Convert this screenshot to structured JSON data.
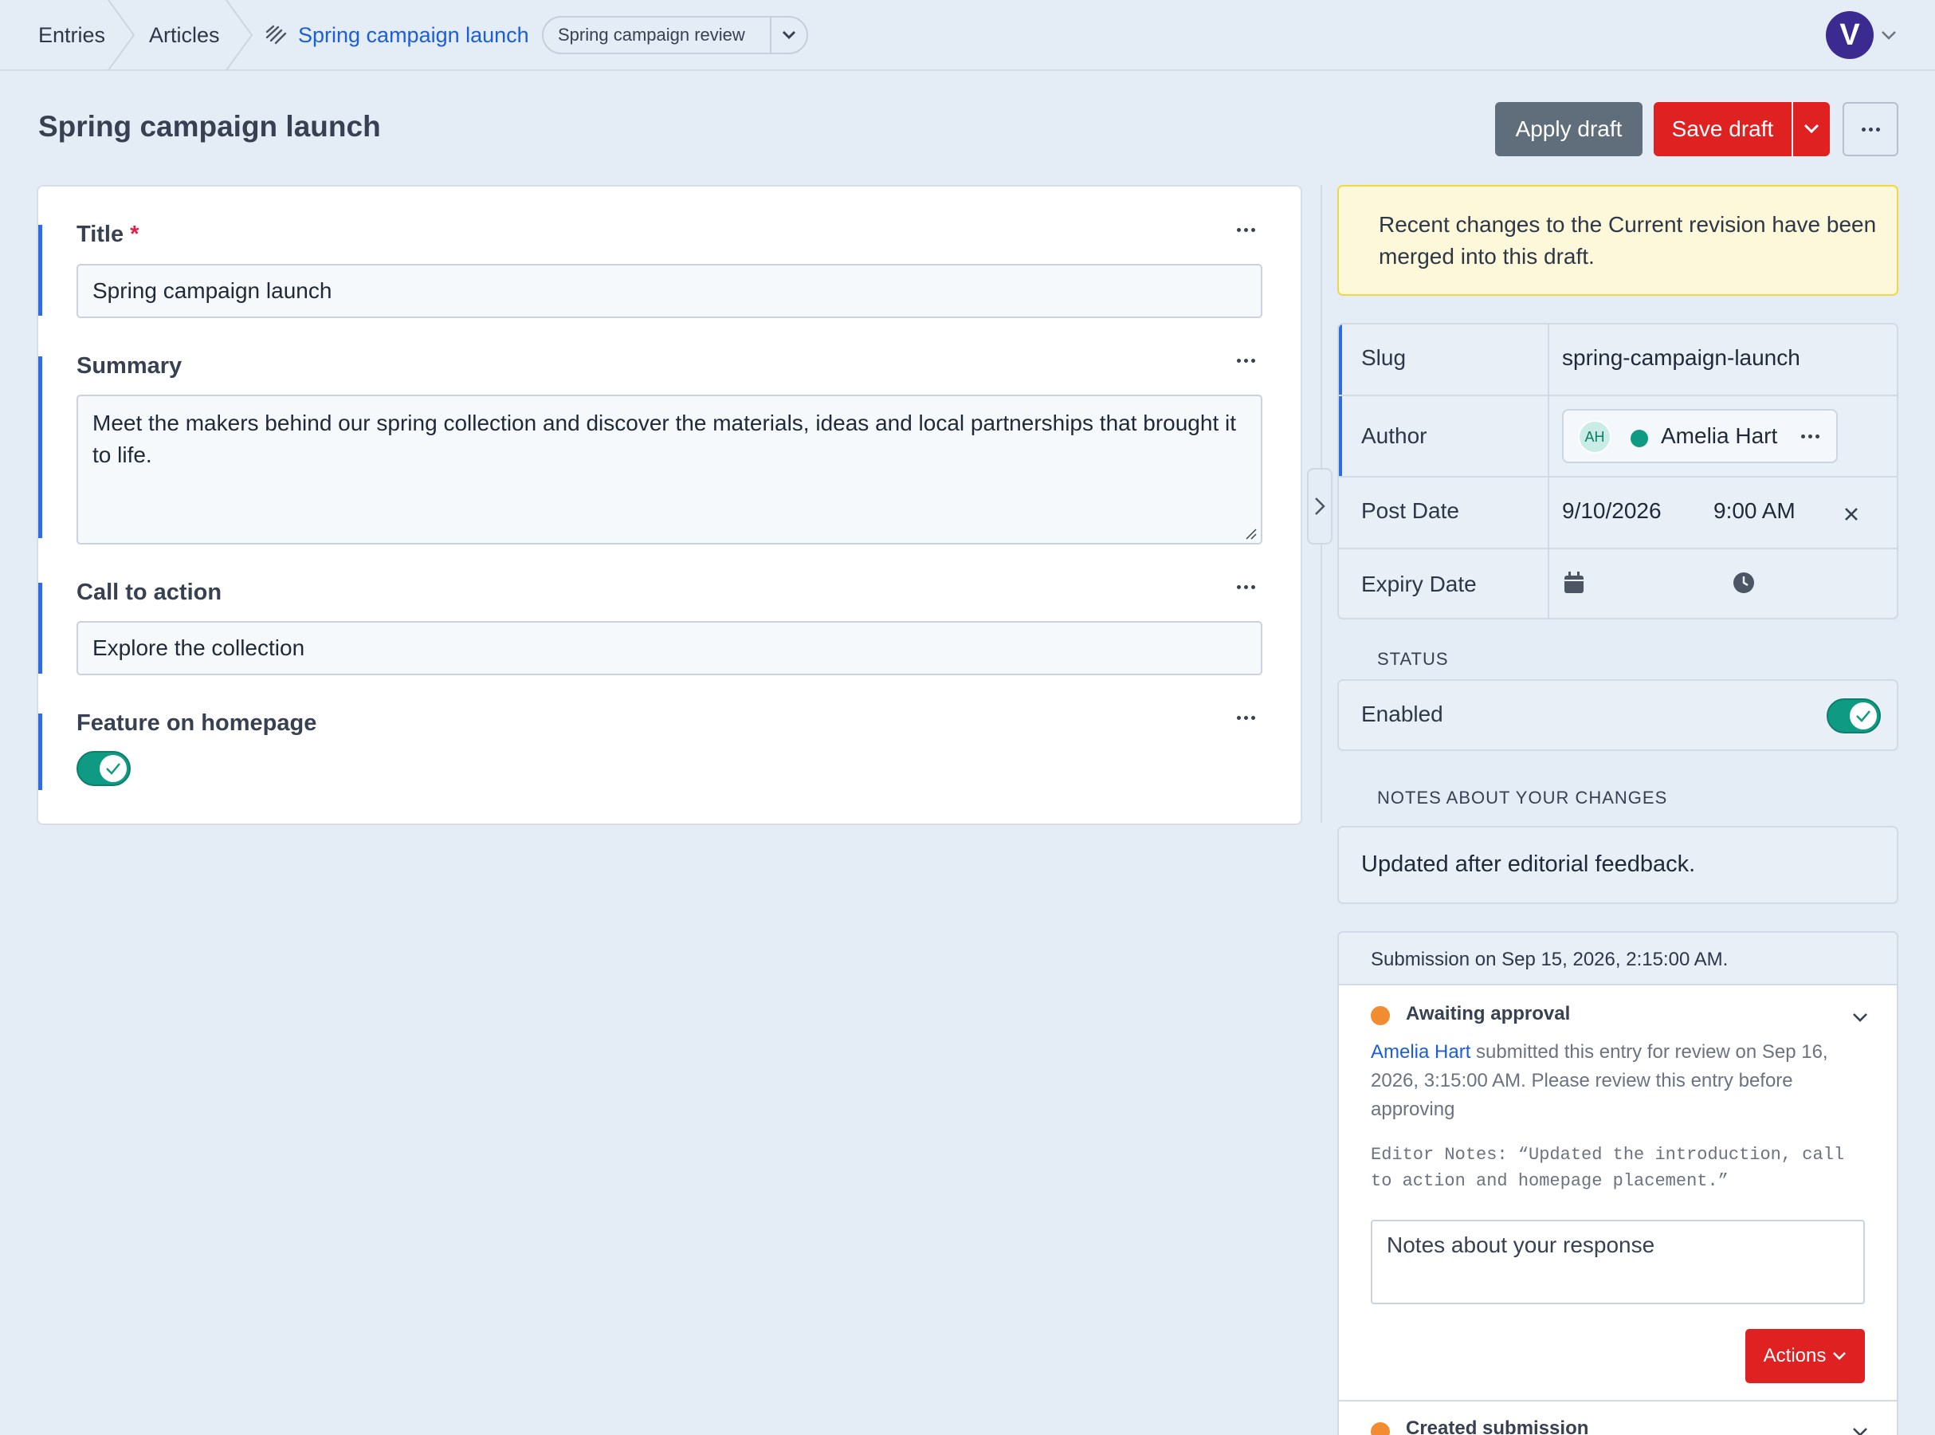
{
  "breadcrumbs": {
    "entries": "Entries",
    "articles": "Articles",
    "current": "Spring campaign launch",
    "draft_selector": "Spring campaign review"
  },
  "user": {
    "avatar_letter": "V"
  },
  "header": {
    "title": "Spring campaign launch",
    "apply_draft": "Apply draft",
    "save_draft": "Save draft"
  },
  "fields": {
    "title": {
      "label": "Title",
      "required_mark": "*",
      "value": "Spring campaign launch"
    },
    "summary": {
      "label": "Summary",
      "value": "Meet the makers behind our spring collection and discover the materials, ideas and local partnerships that brought it to life."
    },
    "cta": {
      "label": "Call to action",
      "value": "Explore the collection"
    },
    "feature": {
      "label": "Feature on homepage",
      "enabled": true
    }
  },
  "notice": {
    "text": "Recent changes to the Current revision have been merged into this draft."
  },
  "meta": {
    "slug": {
      "label": "Slug",
      "value": "spring-campaign-launch"
    },
    "author": {
      "label": "Author",
      "initials": "AH",
      "name": "Amelia Hart"
    },
    "post_date": {
      "label": "Post Date",
      "date": "9/10/2026",
      "time": "9:00 AM"
    },
    "expiry_date": {
      "label": "Expiry Date"
    }
  },
  "status": {
    "heading": "STATUS",
    "label": "Enabled",
    "enabled": true
  },
  "notes": {
    "heading": "NOTES ABOUT YOUR CHANGES",
    "value": "Updated after editorial feedback."
  },
  "submission": {
    "header": "Submission on Sep 15, 2026, 2:15:00 AM.",
    "step_title": "Awaiting approval",
    "submitter": "Amelia Hart",
    "message": " submitted this entry for review on Sep 16, 2026, 3:15:00 AM. Please review this entry before approving",
    "editor_notes": "Editor Notes: “Updated the introduction, call to action and homepage placement.”",
    "response_placeholder": "Notes about your response",
    "actions": "Actions",
    "next_step": "Created submission"
  },
  "colors": {
    "accent_blue": "#2e6be6",
    "danger_red": "#df2121",
    "toggle_green": "#0f9b83",
    "pending_orange": "#f18c30"
  }
}
